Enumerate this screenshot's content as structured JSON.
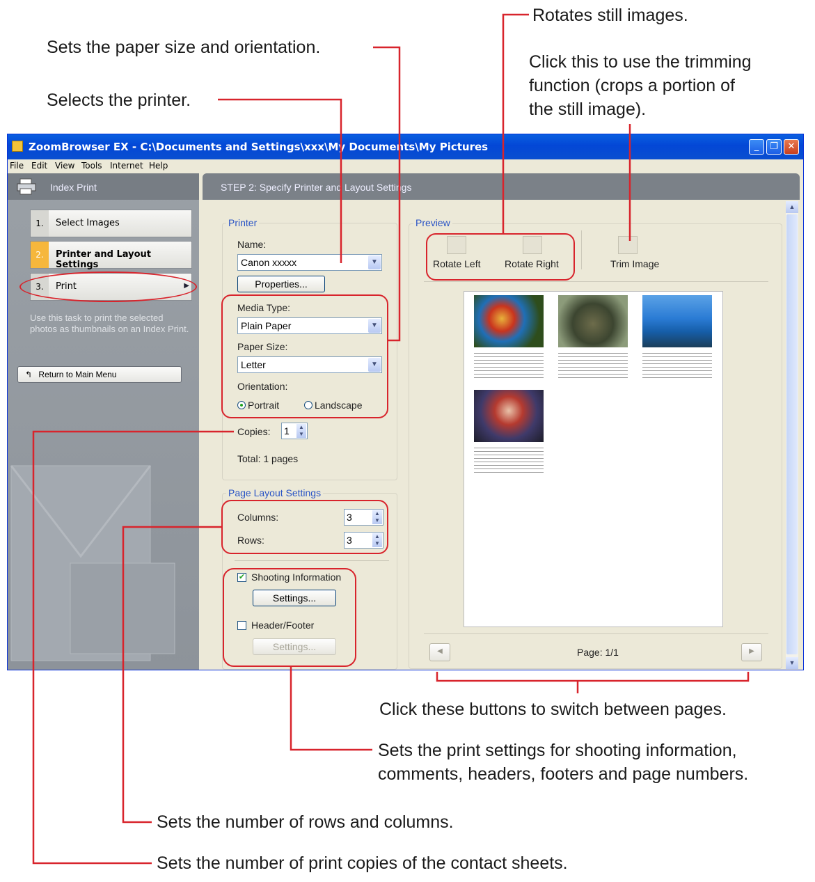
{
  "callouts": {
    "rotates": "Rotates still images.",
    "paper_size": "Sets the paper size and orientation.",
    "trim_line1": "Click this to use the trimming",
    "trim_line2": "function (crops a portion of",
    "trim_line3": "the still image).",
    "printer": "Selects the printer.",
    "pages": "Click these buttons to switch between pages.",
    "shooting_line1": "Sets the print settings for shooting information,",
    "shooting_line2": "comments, headers, footers and page numbers.",
    "rows_cols": "Sets the number of rows and columns.",
    "copies": "Sets the number of print copies of the contact sheets."
  },
  "window": {
    "title": "ZoomBrowser EX  -  C:\\Documents and Settings\\xxx\\My Documents\\My Pictures",
    "menu": [
      "File",
      "Edit",
      "View",
      "Tools",
      "Internet",
      "Help"
    ]
  },
  "left_pane": {
    "header": "Index Print",
    "steps": [
      {
        "num": "1.",
        "label": "Select Images"
      },
      {
        "num": "2.",
        "label": "Printer and Layout Settings"
      },
      {
        "num": "3.",
        "label": "Print"
      }
    ],
    "description": "Use this task to print the selected photos as thumbnails on an Index Print.",
    "return_button": "Return to Main Menu"
  },
  "main": {
    "header": "STEP 2: Specify Printer and Layout Settings",
    "printer_group": "Printer",
    "name_label": "Name:",
    "name_value": "Canon xxxxx",
    "properties_button": "Properties...",
    "media_type_label": "Media Type:",
    "media_type_value": "Plain Paper",
    "paper_size_label": "Paper Size:",
    "paper_size_value": "Letter",
    "orientation_label": "Orientation:",
    "portrait": "Portrait",
    "landscape": "Landscape",
    "copies_label": "Copies:",
    "copies_value": "1",
    "total": "Total: 1 pages",
    "layout_group": "Page Layout Settings",
    "columns_label": "Columns:",
    "columns_value": "3",
    "rows_label": "Rows:",
    "rows_value": "3",
    "shooting_info": "Shooting Information",
    "shooting_checked": true,
    "settings_button": "Settings...",
    "header_footer": "Header/Footer",
    "header_footer_checked": false,
    "settings_button_disabled": "Settings..."
  },
  "preview": {
    "label": "Preview",
    "rotate_left": "Rotate Left",
    "rotate_right": "Rotate Right",
    "trim": "Trim Image",
    "page": "Page: 1/1"
  },
  "colors": {
    "accent": "#d8242c",
    "titlebar": "#0a5fe0",
    "group_label": "#2a54c5"
  }
}
